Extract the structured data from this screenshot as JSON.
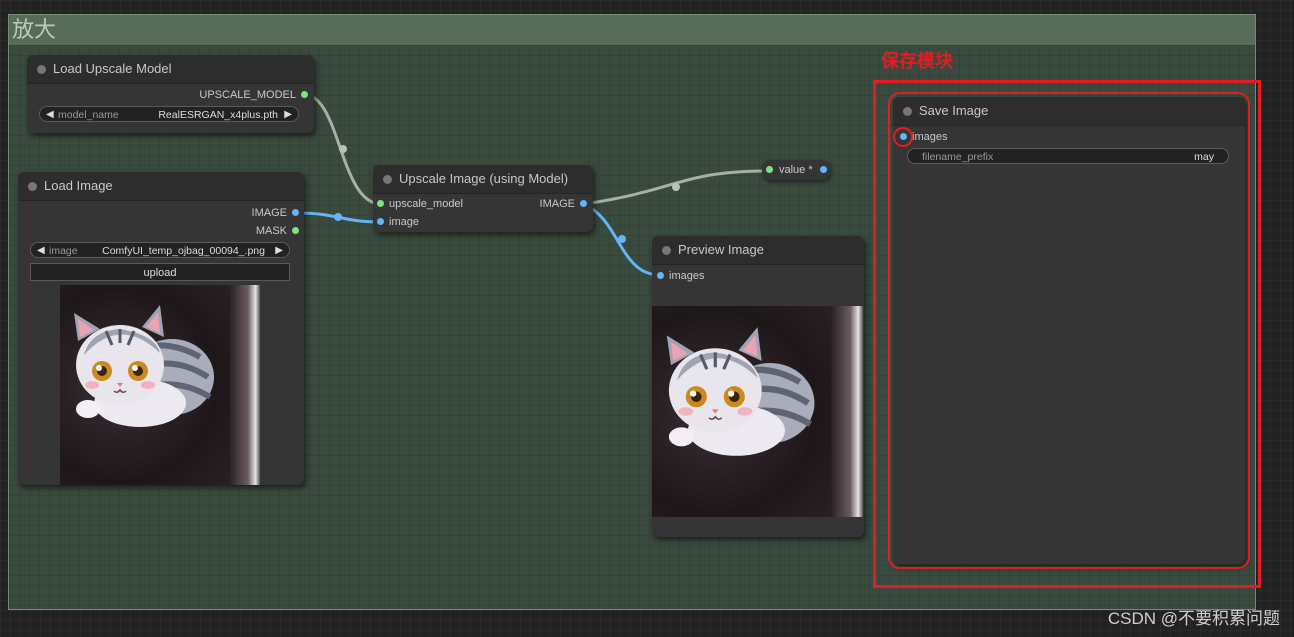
{
  "group": {
    "title": "放大"
  },
  "annotation": {
    "label": "保存模块"
  },
  "watermark": "CSDN @不要积累问题",
  "nodes": {
    "load_upscale_model": {
      "title": "Load Upscale Model",
      "output": "UPSCALE_MODEL",
      "widget_label": "model_name",
      "widget_value": "RealESRGAN_x4plus.pth"
    },
    "load_image": {
      "title": "Load Image",
      "outputs": [
        "IMAGE",
        "MASK"
      ],
      "widget_label": "image",
      "widget_value": "ComfyUI_temp_ojbag_00094_.png",
      "upload_label": "upload"
    },
    "upscale_image": {
      "title": "Upscale Image (using Model)",
      "inputs": [
        "upscale_model",
        "image"
      ],
      "output": "IMAGE"
    },
    "reroute": {
      "label": "value *"
    },
    "preview_image": {
      "title": "Preview Image",
      "input": "images"
    },
    "save_image": {
      "title": "Save Image",
      "input": "images",
      "widget_label": "filename_prefix",
      "widget_value": "may"
    }
  },
  "colors": {
    "group_title_bg": "#566b58",
    "annotation_red": "#e31b23",
    "pin_green": "#7ee37e",
    "pin_blue": "#64b5f6",
    "wire_model": "#b9c4b0",
    "wire_image": "#64b5f6"
  },
  "icons": {
    "arrow_left": "◀",
    "arrow_right": "▶"
  }
}
